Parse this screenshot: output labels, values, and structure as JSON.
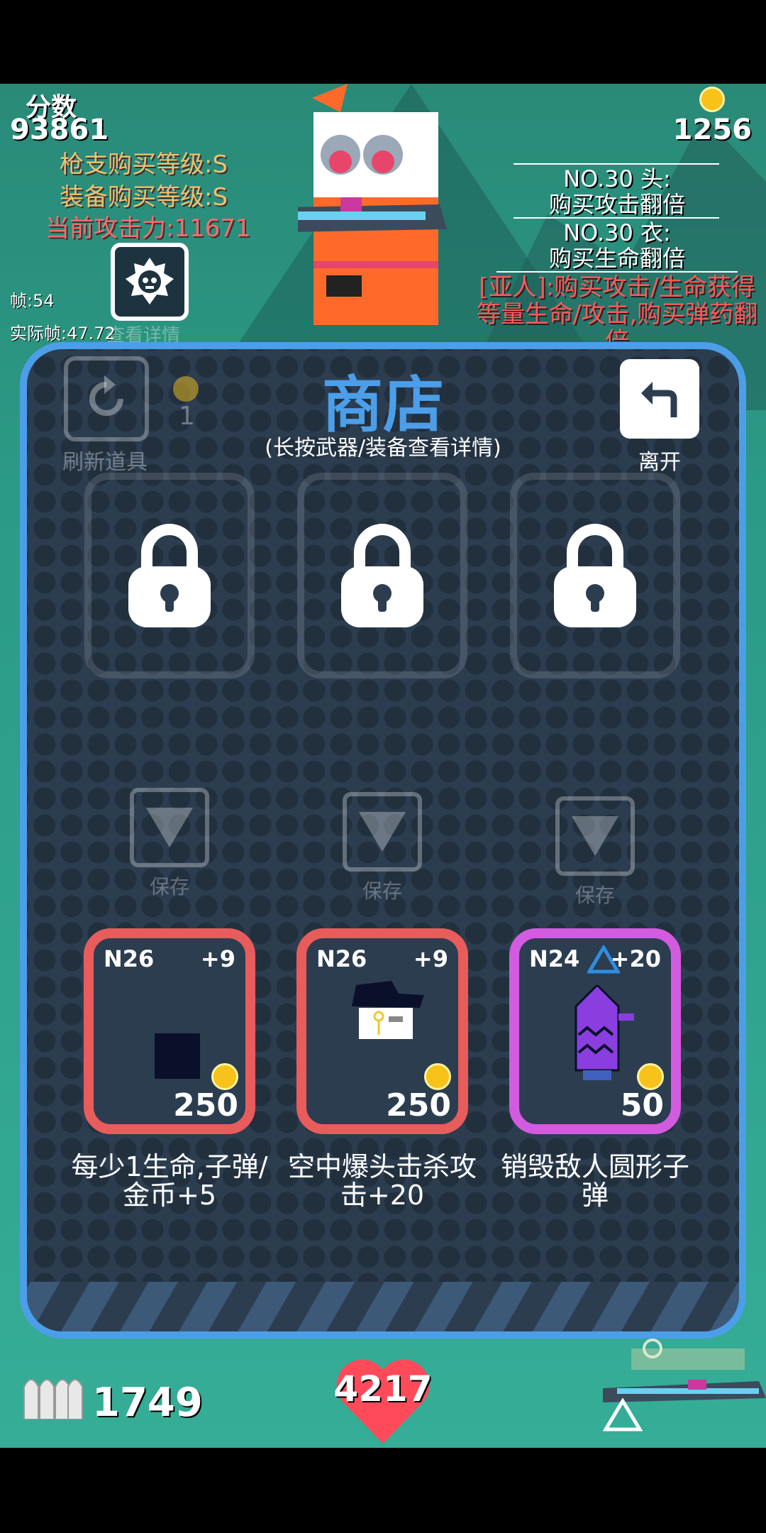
{
  "hud": {
    "score_label": "分数",
    "score_value": "93861",
    "gun_level": "枪支购买等级:S",
    "equip_level": "装备购买等级:S",
    "attack_power": "当前攻击力:11671",
    "coins": "1256",
    "fps": "帧:54",
    "real_fps": "实际帧:47.72",
    "view_detail": "查看详情"
  },
  "bonuses": {
    "head_title": "NO.30 头:",
    "head_desc": "购买攻击翻倍",
    "body_title": "NO.30 衣:",
    "body_desc": "购买生命翻倍",
    "yaren": "[亚人]:购买攻击/生命获得等量生命/攻击,购买弹药翻倍"
  },
  "shop": {
    "title": "商店",
    "subtitle": "(长按武器/装备查看详情)",
    "refresh_label": "刷新道具",
    "refresh_cost": "1",
    "leave_label": "离开",
    "save_label": "保存",
    "locked_slots": 3,
    "items": [
      {
        "level": "N26",
        "bonus": "+9",
        "price": "250",
        "desc": "每少1生命,子弹/金币+5",
        "color": "#e85c5c"
      },
      {
        "level": "N26",
        "bonus": "+9",
        "price": "250",
        "desc": "空中爆头击杀攻击+20",
        "color": "#e85c5c"
      },
      {
        "level": "N24",
        "bonus": "+20",
        "price": "50",
        "desc": "销毁敌人圆形子弹",
        "color": "#d25be0"
      }
    ]
  },
  "bottom": {
    "ammo": "1749",
    "hp": "4217"
  },
  "colors": {
    "panel_border": "#4c9ee8",
    "panel_bg": "#2c3d50",
    "coin": "#f7c21a",
    "red_card": "#e85c5c",
    "purple_card": "#d25be0"
  }
}
